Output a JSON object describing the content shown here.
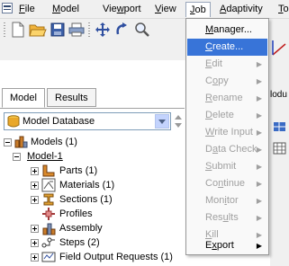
{
  "menubar": {
    "items": [
      {
        "label": "File",
        "mnemonic_index": 0
      },
      {
        "label": "Model",
        "mnemonic_index": 0
      },
      {
        "label": "Viewport",
        "mnemonic_index": 3
      },
      {
        "label": "View",
        "mnemonic_index": 0
      },
      {
        "label": "Job",
        "mnemonic_index": 0
      },
      {
        "label": "Adaptivity",
        "mnemonic_index": 0
      },
      {
        "label": "To",
        "mnemonic_index": 0
      }
    ],
    "open_menu": "Job"
  },
  "toolbar": {
    "icons": [
      "new-file-icon",
      "open-folder-icon",
      "save-icon",
      "print-icon",
      "pan-icon",
      "rotate-icon",
      "zoom-icon"
    ]
  },
  "tabs": [
    {
      "label": "Model",
      "selected": true
    },
    {
      "label": "Results",
      "selected": false
    }
  ],
  "model_selector": {
    "value": "Model Database"
  },
  "right_strip": {
    "fragment": "lodu"
  },
  "tree": [
    {
      "label": "Models (1)",
      "expander": "minus",
      "icon": "models-icon"
    },
    {
      "label": "Model-1",
      "expander": "minus",
      "icon": ""
    },
    {
      "label": "Parts (1)",
      "expander": "plus",
      "icon": "parts-icon"
    },
    {
      "label": "Materials (1)",
      "expander": "plus",
      "icon": "materials-icon"
    },
    {
      "label": "Sections (1)",
      "expander": "plus",
      "icon": "sections-icon"
    },
    {
      "label": "Profiles",
      "expander": "",
      "icon": "profiles-icon"
    },
    {
      "label": "Assembly",
      "expander": "plus",
      "icon": "assembly-icon"
    },
    {
      "label": "Steps (2)",
      "expander": "plus",
      "icon": "steps-icon"
    },
    {
      "label": "Field Output Requests (1)",
      "expander": "plus",
      "icon": "field-output-icon"
    }
  ],
  "job_menu": {
    "items": [
      {
        "label": "Manager...",
        "mnemonic": "M",
        "enabled": true,
        "submenu": false,
        "highlighted": false
      },
      {
        "label": "Create...",
        "mnemonic": "C",
        "enabled": true,
        "submenu": false,
        "highlighted": true
      },
      {
        "label": "Edit",
        "mnemonic": "E",
        "enabled": false,
        "submenu": true,
        "highlighted": false
      },
      {
        "label": "Copy",
        "mnemonic": "o",
        "enabled": false,
        "submenu": true,
        "highlighted": false
      },
      {
        "label": "Rename",
        "mnemonic": "R",
        "enabled": false,
        "submenu": true,
        "highlighted": false
      },
      {
        "label": "Delete",
        "mnemonic": "D",
        "enabled": false,
        "submenu": true,
        "highlighted": false
      },
      {
        "label": "Write Input",
        "mnemonic": "W",
        "enabled": false,
        "submenu": true,
        "highlighted": false
      },
      {
        "label": "Data Check",
        "mnemonic": "a",
        "enabled": false,
        "submenu": true,
        "highlighted": false
      },
      {
        "label": "Submit",
        "mnemonic": "S",
        "enabled": false,
        "submenu": true,
        "highlighted": false
      },
      {
        "label": "Continue",
        "mnemonic": "n",
        "enabled": false,
        "submenu": true,
        "highlighted": false
      },
      {
        "label": "Monitor",
        "mnemonic": "i",
        "enabled": false,
        "submenu": true,
        "highlighted": false
      },
      {
        "label": "Results",
        "mnemonic": "u",
        "enabled": false,
        "submenu": true,
        "highlighted": false
      },
      {
        "label": "Kill",
        "mnemonic": "K",
        "enabled": false,
        "submenu": true,
        "highlighted": false
      },
      {
        "label": "Export",
        "mnemonic": "x",
        "enabled": true,
        "submenu": true,
        "highlighted": false
      }
    ]
  },
  "colors": {
    "highlight": "#3874d8",
    "disabled_text": "#a0a0a0",
    "menubar_bg": "#f0f0f0"
  }
}
